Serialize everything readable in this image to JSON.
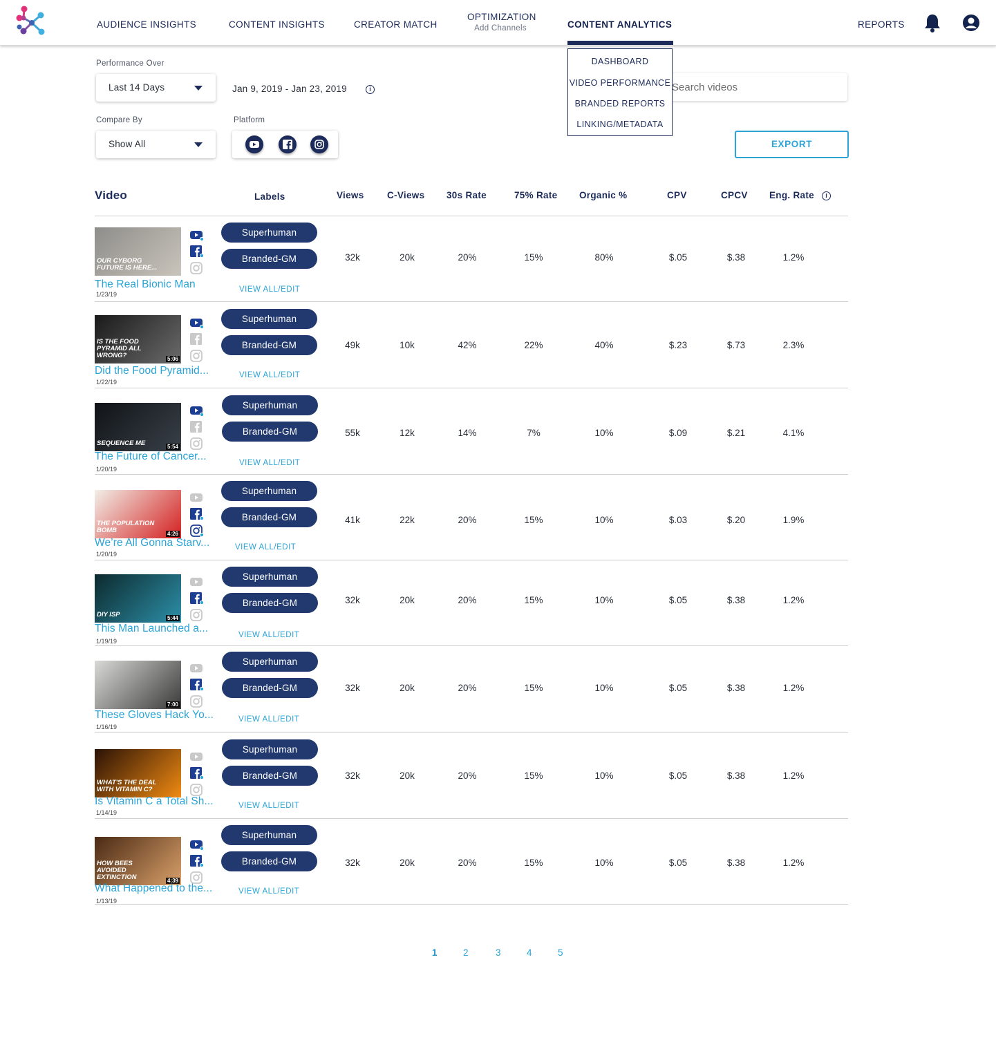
{
  "nav": {
    "items": [
      "AUDIENCE INSIGHTS",
      "CONTENT INSIGHTS",
      "CREATOR MATCH"
    ],
    "optimization": "OPTIMIZATION",
    "optimization_sub": "Add Channels",
    "content_analytics": "CONTENT ANALYTICS",
    "reports": "REPORTS",
    "icons": [
      "logo-icon",
      "bell-icon",
      "user-icon"
    ]
  },
  "menu": [
    "DASHBOARD",
    "VIDEO PERFORMANCE",
    "BRANDED REPORTS",
    "LINKING/METADATA"
  ],
  "filters": {
    "performance_label": "Performance Over",
    "performance_value": "Last 14 Days",
    "date_range": "Jan 9, 2019 - Jan 23, 2019",
    "compare_label": "Compare By",
    "compare_value": "Show All",
    "platform_label": "Platform",
    "platforms": [
      "youtube-icon",
      "facebook-icon",
      "instagram-icon"
    ],
    "search_placeholder": "Search videos",
    "export_label": "EXPORT"
  },
  "table": {
    "headers": [
      "Video",
      "Labels",
      "Views",
      "C-Views",
      "30s Rate",
      "75% Rate",
      "Organic %",
      "CPV",
      "CPCV",
      "Eng. Rate"
    ],
    "label_pills": [
      "Superhuman",
      "Branded-GM"
    ],
    "view_all": "VIEW ALL/EDIT",
    "rows": [
      {
        "title": "The Real Bionic Man",
        "date": "1/23/19",
        "thumb_text": "OUR CYBORG FUTURE IS HERE...",
        "duration": "",
        "thumb_colors": [
          "#8e8d8a",
          "#c9c4bb"
        ],
        "platforms": [
          true,
          true,
          false
        ],
        "values": [
          "32k",
          "20k",
          "20%",
          "15%",
          "80%",
          "$.05",
          "$.38",
          "1.2%"
        ]
      },
      {
        "title": "Did the Food Pyramid...",
        "date": "1/22/19",
        "thumb_text": "IS THE FOOD PYRAMID ALL WRONG?",
        "duration": "5:06",
        "thumb_colors": [
          "#1a1a1a",
          "#6b6b6b"
        ],
        "platforms": [
          true,
          false,
          false
        ],
        "values": [
          "49k",
          "10k",
          "42%",
          "22%",
          "40%",
          "$.23",
          "$.73",
          "2.3%"
        ]
      },
      {
        "title": "The Future of Cancer...",
        "date": "1/20/19",
        "thumb_text": "SEQUENCE ME",
        "duration": "5:54",
        "thumb_colors": [
          "#101418",
          "#3a4048"
        ],
        "platforms": [
          true,
          false,
          false
        ],
        "values": [
          "55k",
          "12k",
          "14%",
          "7%",
          "10%",
          "$.09",
          "$.21",
          "4.1%"
        ]
      },
      {
        "title": "We’re All Gonna Starv...",
        "date": "1/20/19",
        "thumb_text": "THE POPULATION BOMB",
        "duration": "4:26",
        "thumb_colors": [
          "#f2efe8",
          "#d32020"
        ],
        "platforms": [
          false,
          true,
          true
        ],
        "values": [
          "41k",
          "22k",
          "20%",
          "15%",
          "10%",
          "$.03",
          "$.20",
          "1.9%"
        ]
      },
      {
        "title": "This Man Launched a...",
        "date": "1/19/19",
        "thumb_text": "DIY ISP",
        "duration": "5:44",
        "thumb_colors": [
          "#0c2a2e",
          "#2d8fa8"
        ],
        "platforms": [
          false,
          true,
          false
        ],
        "values": [
          "32k",
          "20k",
          "20%",
          "15%",
          "10%",
          "$.05",
          "$.38",
          "1.2%"
        ]
      },
      {
        "title": "These Gloves Hack Yo...",
        "date": "1/16/19",
        "thumb_text": "",
        "duration": "7:00",
        "thumb_colors": [
          "#d9d9d6",
          "#3a3a3a"
        ],
        "platforms": [
          false,
          true,
          false
        ],
        "values": [
          "32k",
          "20k",
          "20%",
          "15%",
          "10%",
          "$.05",
          "$.38",
          "1.2%"
        ]
      },
      {
        "title": "Is Vitamin C a Total Sh...",
        "date": "1/14/19",
        "thumb_text": "WHAT'S THE DEAL WITH VITAMIN C?",
        "duration": "",
        "thumb_colors": [
          "#2a1206",
          "#f08a12"
        ],
        "platforms": [
          false,
          true,
          false
        ],
        "values": [
          "32k",
          "20k",
          "20%",
          "15%",
          "10%",
          "$.05",
          "$.38",
          "1.2%"
        ]
      },
      {
        "title": "What Happened to the...",
        "date": "1/13/19",
        "thumb_text": "HOW BEES AVOIDED EXTINCTION",
        "duration": "4:39",
        "thumb_colors": [
          "#4a2a14",
          "#d9a06a"
        ],
        "platforms": [
          true,
          true,
          false
        ],
        "values": [
          "32k",
          "20k",
          "20%",
          "15%",
          "10%",
          "$.05",
          "$.38",
          "1.2%"
        ]
      }
    ]
  },
  "pagination": [
    "1",
    "2",
    "3",
    "4",
    "5"
  ],
  "colors": {
    "navy": "#1c2b5a",
    "pill": "#21396f",
    "accent": "#2aa3d6",
    "facebook": "#1c3f94"
  }
}
